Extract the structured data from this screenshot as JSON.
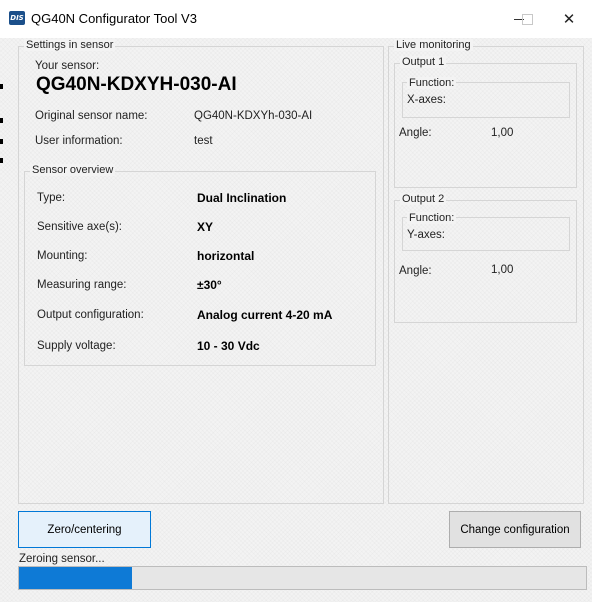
{
  "window": {
    "title": "QG40N Configurator Tool V3",
    "app_icon_text": "DIS"
  },
  "settings": {
    "group_label": "Settings in sensor",
    "your_sensor_label": "Your sensor:",
    "sensor_name": "QG40N-KDXYH-030-AI",
    "original_name_label": "Original sensor name:",
    "original_name_value": "QG40N-KDXYh-030-AI",
    "user_info_label": "User information:",
    "user_info_value": "test"
  },
  "overview": {
    "group_label": "Sensor overview",
    "rows": [
      {
        "label": "Type:",
        "value": "Dual Inclination"
      },
      {
        "label": "Sensitive axe(s):",
        "value": "XY"
      },
      {
        "label": "Mounting:",
        "value": "horizontal"
      },
      {
        "label": "Measuring range:",
        "value": "±30°"
      },
      {
        "label": "Output configuration:",
        "value": "Analog current 4-20 mA"
      },
      {
        "label": "Supply voltage:",
        "value": "10 - 30 Vdc"
      }
    ]
  },
  "monitoring": {
    "group_label": "Live monitoring",
    "outputs": [
      {
        "label": "Output 1",
        "function_label": "Function:",
        "function_value": "X-axes:",
        "angle_label": "Angle:",
        "angle_value": "1,00"
      },
      {
        "label": "Output 2",
        "function_label": "Function:",
        "function_value": "Y-axes:",
        "angle_label": "Angle:",
        "angle_value": "1,00"
      }
    ]
  },
  "actions": {
    "zero_button": "Zero/centering",
    "change_button": "Change configuration"
  },
  "status": {
    "text": "Zeroing sensor...",
    "progress_fraction": 0.2
  }
}
